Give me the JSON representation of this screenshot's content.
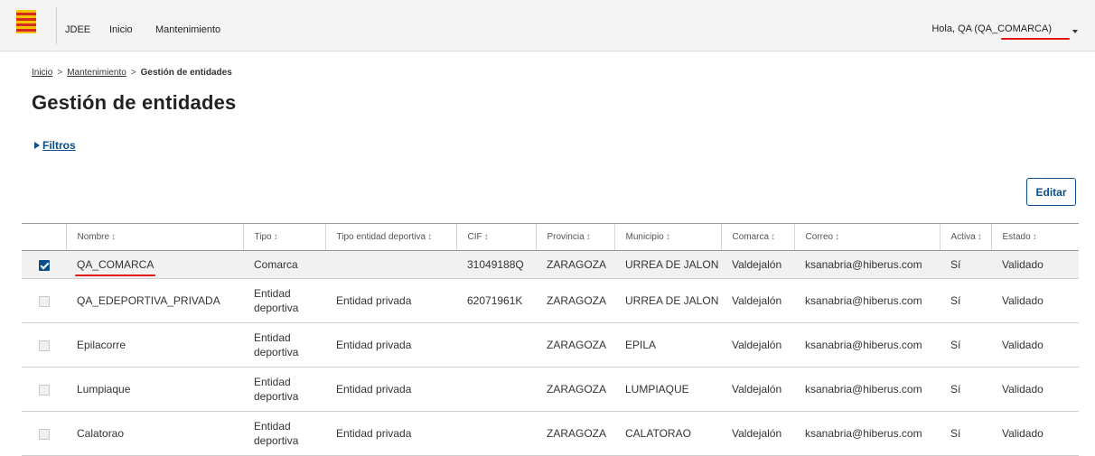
{
  "header": {
    "app_name": "JDEE",
    "nav": [
      "Inicio",
      "Mantenimiento"
    ],
    "greeting_prefix": "Hola, QA (",
    "user_code": "QA_COMARCA",
    "greeting_suffix": ")",
    "accent_red": "#e11818",
    "logo_colors": [
      "#f5c400",
      "#d72a1e"
    ]
  },
  "breadcrumb": {
    "items": [
      "Inicio",
      "Mantenimiento"
    ],
    "current": "Gestión de entidades",
    "separator": ">"
  },
  "page": {
    "title": "Gestión de entidades",
    "filters_label": "Filtros",
    "edit_label": "Editar",
    "primary_color": "#0b4f8a"
  },
  "table": {
    "sort_glyph": "↕",
    "columns": [
      "Nombre",
      "Tipo",
      "Tipo entidad deportiva",
      "CIF",
      "Provincia",
      "Municipio",
      "Comarca",
      "Correo",
      "Activa",
      "Estado"
    ],
    "rows": [
      {
        "checked": true,
        "nombre": "QA_COMARCA",
        "tipo": "Comarca",
        "tipo_deportiva": "",
        "cif": "31049188Q",
        "provincia": "ZARAGOZA",
        "municipio": "URREA DE JALON",
        "comarca": "Valdejalón",
        "correo": "ksanabria@hiberus.com",
        "activa": "Sí",
        "estado": "Validado"
      },
      {
        "checked": false,
        "nombre": "QA_EDEPORTIVA_PRIVADA",
        "tipo": "Entidad deportiva",
        "tipo_deportiva": "Entidad privada",
        "cif": "62071961K",
        "provincia": "ZARAGOZA",
        "municipio": "URREA DE JALON",
        "comarca": "Valdejalón",
        "correo": "ksanabria@hiberus.com",
        "activa": "Sí",
        "estado": "Validado"
      },
      {
        "checked": false,
        "nombre": "Epilacorre",
        "tipo": "Entidad deportiva",
        "tipo_deportiva": "Entidad privada",
        "cif": "",
        "provincia": "ZARAGOZA",
        "municipio": "EPILA",
        "comarca": "Valdejalón",
        "correo": "ksanabria@hiberus.com",
        "activa": "Sí",
        "estado": "Validado"
      },
      {
        "checked": false,
        "nombre": "Lumpiaque",
        "tipo": "Entidad deportiva",
        "tipo_deportiva": "Entidad privada",
        "cif": "",
        "provincia": "ZARAGOZA",
        "municipio": "LUMPIAQUE",
        "comarca": "Valdejalón",
        "correo": "ksanabria@hiberus.com",
        "activa": "Sí",
        "estado": "Validado"
      },
      {
        "checked": false,
        "nombre": "Calatorao",
        "tipo": "Entidad deportiva",
        "tipo_deportiva": "Entidad privada",
        "cif": "",
        "provincia": "ZARAGOZA",
        "municipio": "CALATORAO",
        "comarca": "Valdejalón",
        "correo": "ksanabria@hiberus.com",
        "activa": "Sí",
        "estado": "Validado"
      }
    ]
  }
}
